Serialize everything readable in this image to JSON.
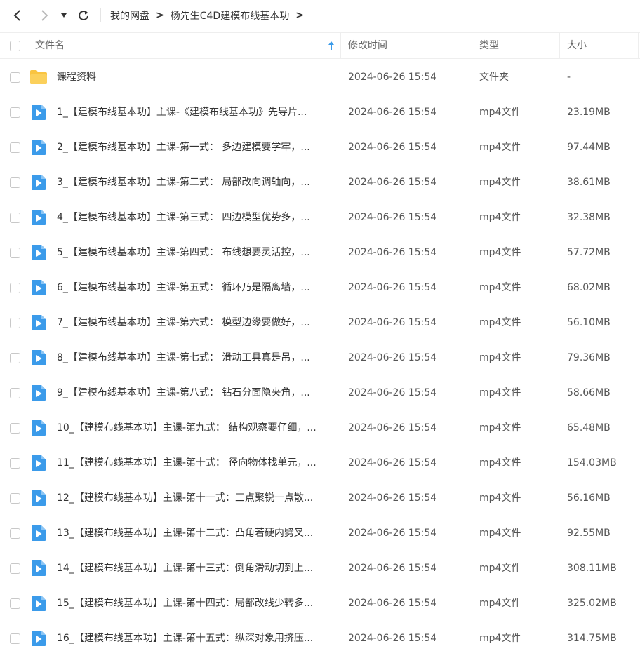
{
  "nav": {
    "breadcrumbs": [
      "我的网盘",
      "杨先生C4D建模布线基本功"
    ]
  },
  "columns": {
    "name": "文件名",
    "modified": "修改时间",
    "type": "类型",
    "size": "大小"
  },
  "colors": {
    "accent": "#3b9bea",
    "folder": "#f9c441"
  },
  "rows": [
    {
      "icon": "folder-icon",
      "name": "课程资料",
      "modified": "2024-06-26 15:54",
      "type": "文件夹",
      "size": "-"
    },
    {
      "icon": "video-file-icon",
      "name": "1_【建模布线基本功】主课-《建模布线基本功》先导片...",
      "modified": "2024-06-26 15:54",
      "type": "mp4文件",
      "size": "23.19MB"
    },
    {
      "icon": "video-file-icon",
      "name": "2_【建模布线基本功】主课-第一式： 多边建模要学牢，...",
      "modified": "2024-06-26 15:54",
      "type": "mp4文件",
      "size": "97.44MB"
    },
    {
      "icon": "video-file-icon",
      "name": "3_【建模布线基本功】主课-第二式： 局部改向调轴向，...",
      "modified": "2024-06-26 15:54",
      "type": "mp4文件",
      "size": "38.61MB"
    },
    {
      "icon": "video-file-icon",
      "name": "4_【建模布线基本功】主课-第三式： 四边模型优势多，...",
      "modified": "2024-06-26 15:54",
      "type": "mp4文件",
      "size": "32.38MB"
    },
    {
      "icon": "video-file-icon",
      "name": "5_【建模布线基本功】主课-第四式： 布线想要灵活控，...",
      "modified": "2024-06-26 15:54",
      "type": "mp4文件",
      "size": "57.72MB"
    },
    {
      "icon": "video-file-icon",
      "name": "6_【建模布线基本功】主课-第五式： 循环乃是隔离墙，...",
      "modified": "2024-06-26 15:54",
      "type": "mp4文件",
      "size": "68.02MB"
    },
    {
      "icon": "video-file-icon",
      "name": "7_【建模布线基本功】主课-第六式： 模型边缘要做好，...",
      "modified": "2024-06-26 15:54",
      "type": "mp4文件",
      "size": "56.10MB"
    },
    {
      "icon": "video-file-icon",
      "name": "8_【建模布线基本功】主课-第七式： 滑动工具真是吊，...",
      "modified": "2024-06-26 15:54",
      "type": "mp4文件",
      "size": "79.36MB"
    },
    {
      "icon": "video-file-icon",
      "name": "9_【建模布线基本功】主课-第八式： 钻石分面隐夹角，...",
      "modified": "2024-06-26 15:54",
      "type": "mp4文件",
      "size": "58.66MB"
    },
    {
      "icon": "video-file-icon",
      "name": "10_【建模布线基本功】主课-第九式： 结构观察要仔细，...",
      "modified": "2024-06-26 15:54",
      "type": "mp4文件",
      "size": "65.48MB"
    },
    {
      "icon": "video-file-icon",
      "name": "11_【建模布线基本功】主课-第十式： 径向物体找单元，...",
      "modified": "2024-06-26 15:54",
      "type": "mp4文件",
      "size": "154.03MB"
    },
    {
      "icon": "video-file-icon",
      "name": "12_【建模布线基本功】主课-第十一式：三点聚锐一点散...",
      "modified": "2024-06-26 15:54",
      "type": "mp4文件",
      "size": "56.16MB"
    },
    {
      "icon": "video-file-icon",
      "name": "13_【建模布线基本功】主课-第十二式：凸角若硬内劈叉...",
      "modified": "2024-06-26 15:54",
      "type": "mp4文件",
      "size": "92.55MB"
    },
    {
      "icon": "video-file-icon",
      "name": "14_【建模布线基本功】主课-第十三式：倒角滑动切到上...",
      "modified": "2024-06-26 15:54",
      "type": "mp4文件",
      "size": "308.11MB"
    },
    {
      "icon": "video-file-icon",
      "name": "15_【建模布线基本功】主课-第十四式：局部改线少转多...",
      "modified": "2024-06-26 15:54",
      "type": "mp4文件",
      "size": "325.02MB"
    },
    {
      "icon": "video-file-icon",
      "name": "16_【建模布线基本功】主课-第十五式：纵深对象用挤压...",
      "modified": "2024-06-26 15:54",
      "type": "mp4文件",
      "size": "314.75MB"
    }
  ]
}
